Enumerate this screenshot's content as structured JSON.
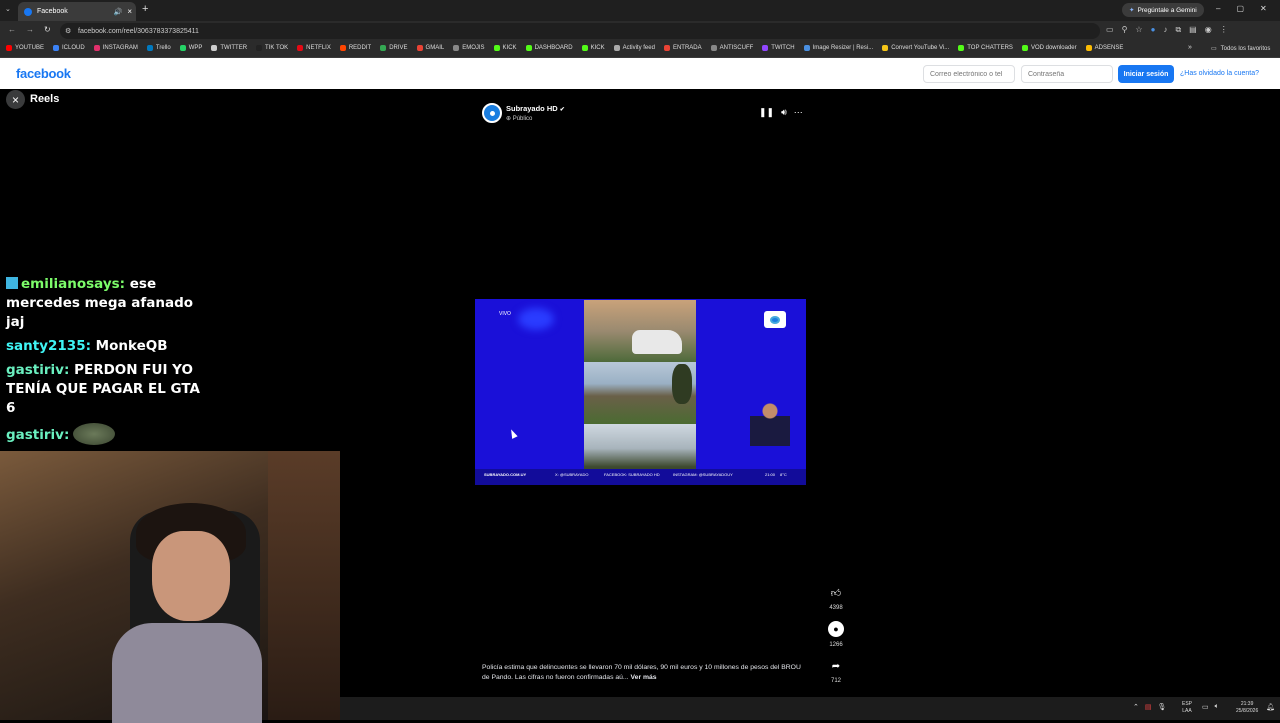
{
  "browser": {
    "tab_title": "Facebook",
    "url": "facebook.com/reel/3063783373825411",
    "gemini": "Pregúntale a Gemini",
    "bookmarks": [
      {
        "label": "YOUTUBE",
        "color": "#ff0000"
      },
      {
        "label": "ICLOUD",
        "color": "#3b82f6"
      },
      {
        "label": "INSTAGRAM",
        "color": "#e1306c"
      },
      {
        "label": "Trello",
        "color": "#0079bf"
      },
      {
        "label": "WPP",
        "color": "#25d366"
      },
      {
        "label": "TWITTER",
        "color": "#cccccc"
      },
      {
        "label": "TIK TOK",
        "color": "#222222"
      },
      {
        "label": "NETFLIX",
        "color": "#e50914"
      },
      {
        "label": "REDDIT",
        "color": "#ff4500"
      },
      {
        "label": "DRIVE",
        "color": "#34a853"
      },
      {
        "label": "GMAIL",
        "color": "#ea4335"
      },
      {
        "label": "EMOJIS",
        "color": "#888888"
      },
      {
        "label": "KICK",
        "color": "#53fc18"
      },
      {
        "label": "DASHBOARD",
        "color": "#53fc18"
      },
      {
        "label": "KICK",
        "color": "#53fc18"
      },
      {
        "label": "Activity feed",
        "color": "#aaaaaa"
      },
      {
        "label": "ENTRADA",
        "color": "#ea4335"
      },
      {
        "label": "ANTISCUFF",
        "color": "#888888"
      },
      {
        "label": "TWITCH",
        "color": "#9146ff"
      },
      {
        "label": "Image Resizer | Resi...",
        "color": "#4a90e2"
      },
      {
        "label": "Convert YouTube Vi...",
        "color": "#f5c518"
      },
      {
        "label": "TOP CHATTERS",
        "color": "#53fc18"
      },
      {
        "label": "VOD downloader",
        "color": "#53fc18"
      },
      {
        "label": "ADSENSE",
        "color": "#fbbc04"
      }
    ],
    "all_bookmarks": "Todos los favoritos"
  },
  "facebook": {
    "logo": "facebook",
    "email_placeholder": "Correo electrónico o tel",
    "password_placeholder": "Contraseña",
    "login": "Iniciar sesión",
    "forgot": "¿Has olvidado la cuenta?"
  },
  "reels": {
    "title": "Reels",
    "page_name": "Subrayado HD",
    "privacy": "Público",
    "overlay": {
      "vivo": "VIVO",
      "site": "SUBRAYADO.COM.UY",
      "x": "X: @SUBRAYADO",
      "facebook": "FACEBOOK: SUBRAYADO HD",
      "instagram": "INSTAGRAM: @SUBRAYADOUY",
      "time": "21:00",
      "temp": "8°C"
    },
    "likes": "4398",
    "comments": "1266",
    "shares": "712",
    "caption": "Policía estima que delincuentes se llevaron 70 mil dólares, 90 mil euros y 10 millones de pesos del BROU de Pando. Las cifras no fueron confirmadas aú...",
    "see_more": "Ver más"
  },
  "chat": [
    {
      "user": "emilianosays:",
      "msg": " ese mercedes mega afanado jaj",
      "color": "#7cfc6a"
    },
    {
      "user": "santy2135:",
      "msg": " MonkeQB",
      "color": "#3ff5f5"
    },
    {
      "user": "gastiriv:",
      "msg": " PERDON FUI YO TENÍA QUE PAGAR EL GTA 6",
      "color": "#6af0c0"
    },
    {
      "user": "gastiriv:",
      "msg": "",
      "color": "#6af0c0"
    }
  ],
  "taskbar": {
    "lang1": "ESP",
    "lang2": "LAA",
    "time": "21:39",
    "date": "25/8/2026"
  }
}
